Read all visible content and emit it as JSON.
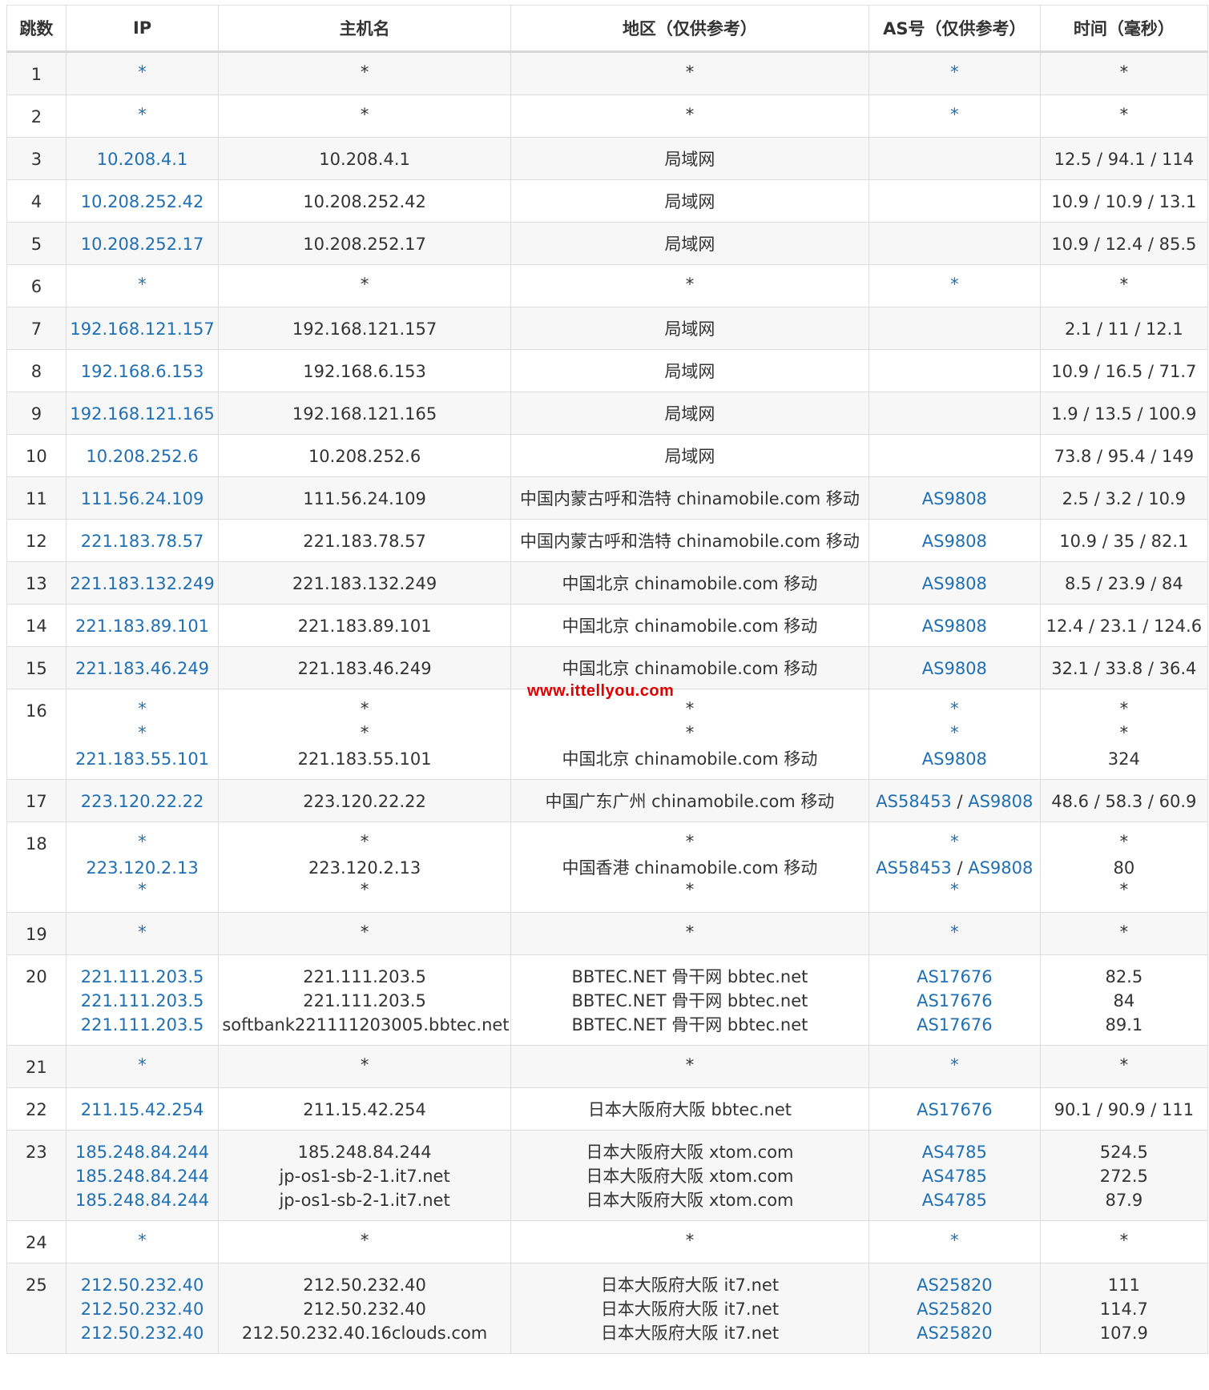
{
  "headers": [
    "跳数",
    "IP",
    "主机名",
    "地区（仅供参考）",
    "AS号（仅供参考）",
    "时间（毫秒）"
  ],
  "watermark": "www.ittellyou.com",
  "rows": [
    {
      "hop": "1",
      "lines": [
        {
          "ip": "*",
          "host": "*",
          "region": "*",
          "as": [
            "*"
          ],
          "time": "*"
        }
      ]
    },
    {
      "hop": "2",
      "lines": [
        {
          "ip": "*",
          "host": "*",
          "region": "*",
          "as": [
            "*"
          ],
          "time": "*"
        }
      ]
    },
    {
      "hop": "3",
      "lines": [
        {
          "ip": "10.208.4.1",
          "host": "10.208.4.1",
          "region": "局域网",
          "as": [],
          "time": "12.5 / 94.1 / 114"
        }
      ]
    },
    {
      "hop": "4",
      "lines": [
        {
          "ip": "10.208.252.42",
          "host": "10.208.252.42",
          "region": "局域网",
          "as": [],
          "time": "10.9 / 10.9 / 13.1"
        }
      ]
    },
    {
      "hop": "5",
      "lines": [
        {
          "ip": "10.208.252.17",
          "host": "10.208.252.17",
          "region": "局域网",
          "as": [],
          "time": "10.9 / 12.4 / 85.5"
        }
      ]
    },
    {
      "hop": "6",
      "lines": [
        {
          "ip": "*",
          "host": "*",
          "region": "*",
          "as": [
            "*"
          ],
          "time": "*"
        }
      ]
    },
    {
      "hop": "7",
      "lines": [
        {
          "ip": "192.168.121.157",
          "host": "192.168.121.157",
          "region": "局域网",
          "as": [],
          "time": "2.1 / 11 / 12.1"
        }
      ]
    },
    {
      "hop": "8",
      "lines": [
        {
          "ip": "192.168.6.153",
          "host": "192.168.6.153",
          "region": "局域网",
          "as": [],
          "time": "10.9 / 16.5 / 71.7"
        }
      ]
    },
    {
      "hop": "9",
      "lines": [
        {
          "ip": "192.168.121.165",
          "host": "192.168.121.165",
          "region": "局域网",
          "as": [],
          "time": "1.9 / 13.5 / 100.9"
        }
      ]
    },
    {
      "hop": "10",
      "lines": [
        {
          "ip": "10.208.252.6",
          "host": "10.208.252.6",
          "region": "局域网",
          "as": [],
          "time": "73.8 / 95.4 / 149"
        }
      ]
    },
    {
      "hop": "11",
      "lines": [
        {
          "ip": "111.56.24.109",
          "host": "111.56.24.109",
          "region": "中国内蒙古呼和浩特 chinamobile.com 移动",
          "as": [
            "AS9808"
          ],
          "time": "2.5 / 3.2 / 10.9"
        }
      ]
    },
    {
      "hop": "12",
      "lines": [
        {
          "ip": "221.183.78.57",
          "host": "221.183.78.57",
          "region": "中国内蒙古呼和浩特 chinamobile.com 移动",
          "as": [
            "AS9808"
          ],
          "time": "10.9 / 35 / 82.1"
        }
      ]
    },
    {
      "hop": "13",
      "lines": [
        {
          "ip": "221.183.132.249",
          "host": "221.183.132.249",
          "region": "中国北京 chinamobile.com 移动",
          "as": [
            "AS9808"
          ],
          "time": "8.5 / 23.9 / 84"
        }
      ]
    },
    {
      "hop": "14",
      "lines": [
        {
          "ip": "221.183.89.101",
          "host": "221.183.89.101",
          "region": "中国北京 chinamobile.com 移动",
          "as": [
            "AS9808"
          ],
          "time": "12.4 / 23.1 / 124.6"
        }
      ]
    },
    {
      "hop": "15",
      "lines": [
        {
          "ip": "221.183.46.249",
          "host": "221.183.46.249",
          "region": "中国北京 chinamobile.com 移动",
          "as": [
            "AS9808"
          ],
          "time": "32.1 / 33.8 / 36.4"
        }
      ]
    },
    {
      "hop": "16",
      "lines": [
        {
          "ip": "*",
          "host": "*",
          "region": "*",
          "as": [
            "*"
          ],
          "time": "*"
        },
        {
          "ip": "*",
          "host": "*",
          "region": "*",
          "as": [
            "*"
          ],
          "time": "*"
        },
        {
          "ip": "221.183.55.101",
          "host": "221.183.55.101",
          "region": "中国北京 chinamobile.com 移动",
          "as": [
            "AS9808"
          ],
          "time": "324"
        }
      ]
    },
    {
      "hop": "17",
      "lines": [
        {
          "ip": "223.120.22.22",
          "host": "223.120.22.22",
          "region": "中国广东广州 chinamobile.com 移动",
          "as": [
            "AS58453",
            "AS9808"
          ],
          "time": "48.6 / 58.3 / 60.9"
        }
      ]
    },
    {
      "hop": "18",
      "lines": [
        {
          "ip": "*",
          "host": "*",
          "region": "*",
          "as": [
            "*"
          ],
          "time": "*"
        },
        {
          "ip": "223.120.2.13",
          "host": "223.120.2.13",
          "region": "中国香港 chinamobile.com 移动",
          "as": [
            "AS58453",
            "AS9808"
          ],
          "time": "80"
        },
        {
          "ip": "*",
          "host": "*",
          "region": "*",
          "as": [
            "*"
          ],
          "time": "*"
        }
      ]
    },
    {
      "hop": "19",
      "lines": [
        {
          "ip": "*",
          "host": "*",
          "region": "*",
          "as": [
            "*"
          ],
          "time": "*"
        }
      ]
    },
    {
      "hop": "20",
      "lines": [
        {
          "ip": "221.111.203.5",
          "host": "221.111.203.5",
          "region": "BBTEC.NET 骨干网 bbtec.net",
          "as": [
            "AS17676"
          ],
          "time": "82.5"
        },
        {
          "ip": "221.111.203.5",
          "host": "221.111.203.5",
          "region": "BBTEC.NET 骨干网 bbtec.net",
          "as": [
            "AS17676"
          ],
          "time": "84"
        },
        {
          "ip": "221.111.203.5",
          "host": "softbank221111203005.bbtec.net",
          "region": "BBTEC.NET 骨干网 bbtec.net",
          "as": [
            "AS17676"
          ],
          "time": "89.1"
        }
      ]
    },
    {
      "hop": "21",
      "lines": [
        {
          "ip": "*",
          "host": "*",
          "region": "*",
          "as": [
            "*"
          ],
          "time": "*"
        }
      ]
    },
    {
      "hop": "22",
      "lines": [
        {
          "ip": "211.15.42.254",
          "host": "211.15.42.254",
          "region": "日本大阪府大阪 bbtec.net",
          "as": [
            "AS17676"
          ],
          "time": "90.1 / 90.9 / 111"
        }
      ]
    },
    {
      "hop": "23",
      "lines": [
        {
          "ip": "185.248.84.244",
          "host": "185.248.84.244",
          "region": "日本大阪府大阪 xtom.com",
          "as": [
            "AS4785"
          ],
          "time": "524.5"
        },
        {
          "ip": "185.248.84.244",
          "host": "jp-os1-sb-2-1.it7.net",
          "region": "日本大阪府大阪 xtom.com",
          "as": [
            "AS4785"
          ],
          "time": "272.5"
        },
        {
          "ip": "185.248.84.244",
          "host": "jp-os1-sb-2-1.it7.net",
          "region": "日本大阪府大阪 xtom.com",
          "as": [
            "AS4785"
          ],
          "time": "87.9"
        }
      ]
    },
    {
      "hop": "24",
      "lines": [
        {
          "ip": "*",
          "host": "*",
          "region": "*",
          "as": [
            "*"
          ],
          "time": "*"
        }
      ]
    },
    {
      "hop": "25",
      "lines": [
        {
          "ip": "212.50.232.40",
          "host": "212.50.232.40",
          "region": "日本大阪府大阪 it7.net",
          "as": [
            "AS25820"
          ],
          "time": "111"
        },
        {
          "ip": "212.50.232.40",
          "host": "212.50.232.40",
          "region": "日本大阪府大阪 it7.net",
          "as": [
            "AS25820"
          ],
          "time": "114.7"
        },
        {
          "ip": "212.50.232.40",
          "host": "212.50.232.40.16clouds.com",
          "region": "日本大阪府大阪 it7.net",
          "as": [
            "AS25820"
          ],
          "time": "107.9"
        }
      ]
    }
  ]
}
